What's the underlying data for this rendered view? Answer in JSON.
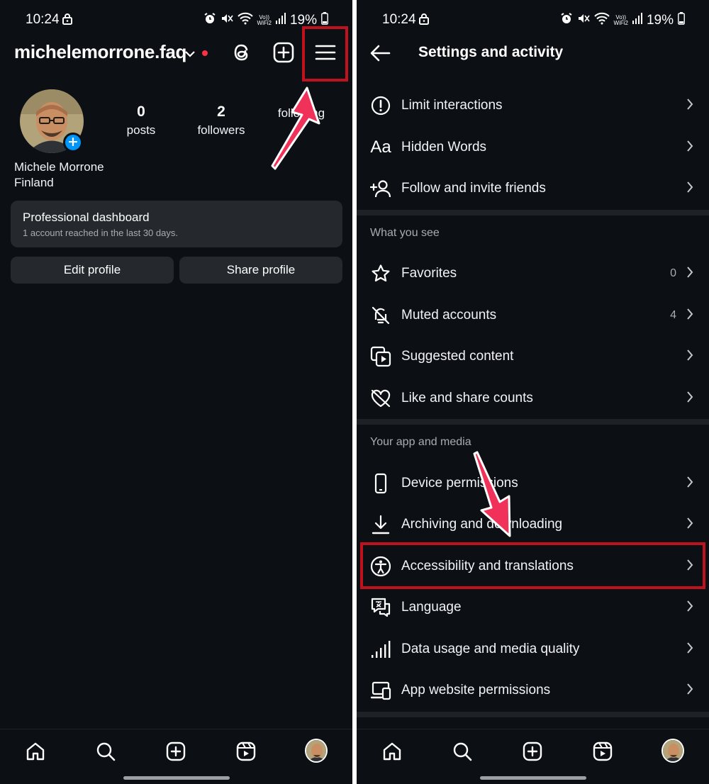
{
  "status_bar": {
    "time": "10:24",
    "volte_top": "Vo))",
    "volte_bottom": "WiFi2",
    "battery": "19%"
  },
  "profile_screen": {
    "username": "michelemorrone.faq",
    "stats": [
      {
        "count": "0",
        "label": "posts"
      },
      {
        "count": "2",
        "label": "followers"
      },
      {
        "count": "",
        "label": "following"
      }
    ],
    "name": "Michele Morrone",
    "location": "Finland",
    "dashboard": {
      "title": "Professional dashboard",
      "subtitle": "1 account reached in the last 30 days."
    },
    "edit_label": "Edit profile",
    "share_label": "Share profile"
  },
  "settings_screen": {
    "title": "Settings and activity",
    "top_items": [
      {
        "label": "Limit interactions",
        "icon": "alert-circle-icon"
      },
      {
        "label": "Hidden Words",
        "icon": "text-aa-icon"
      },
      {
        "label": "Follow and invite friends",
        "icon": "add-person-icon"
      }
    ],
    "section_what_you_see": "What you see",
    "see_items": [
      {
        "label": "Favorites",
        "count": "0",
        "icon": "star-icon"
      },
      {
        "label": "Muted accounts",
        "count": "4",
        "icon": "muted-bell-icon"
      },
      {
        "label": "Suggested content",
        "count": "",
        "icon": "suggested-content-icon"
      },
      {
        "label": "Like and share counts",
        "count": "",
        "icon": "heart-off-icon"
      }
    ],
    "section_app_media": "Your app and media",
    "app_items": [
      {
        "label": "Device permissions",
        "icon": "phone-icon"
      },
      {
        "label": "Archiving and downloading",
        "icon": "download-icon"
      },
      {
        "label": "Accessibility and translations",
        "icon": "accessibility-icon"
      },
      {
        "label": "Language",
        "icon": "translate-icon"
      },
      {
        "label": "Data usage and media quality",
        "icon": "signal-bars-icon"
      },
      {
        "label": "App website permissions",
        "icon": "devices-icon"
      }
    ]
  },
  "colors": {
    "background": "#0c0f14",
    "card": "#25292e",
    "highlight": "#c0121e",
    "arrow": "#f0325a",
    "notification_dot": "#ff3040",
    "badge": "#0095f6"
  }
}
